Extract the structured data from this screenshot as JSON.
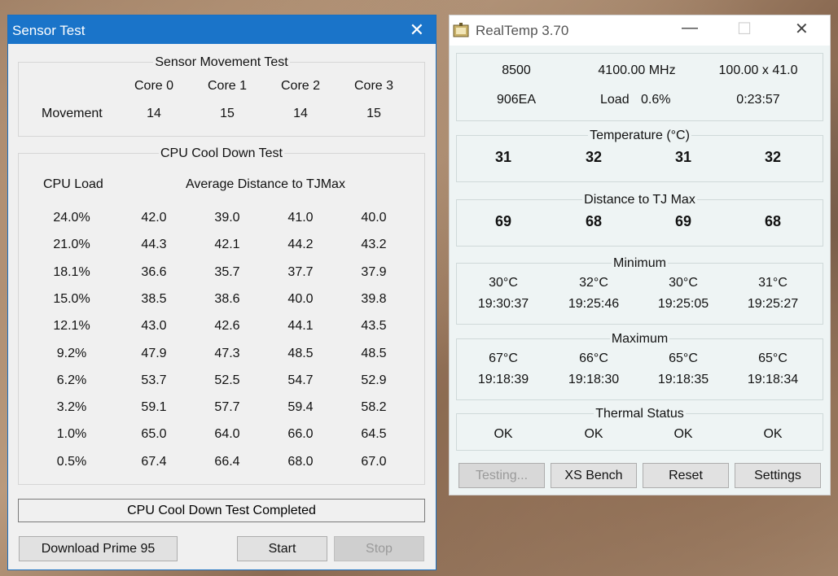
{
  "sensor_window": {
    "title": "Sensor Test",
    "movement_group": {
      "title": "Sensor Movement Test",
      "cores": [
        "Core 0",
        "Core 1",
        "Core 2",
        "Core 3"
      ],
      "row_label": "Movement",
      "values": [
        "14",
        "15",
        "14",
        "15"
      ]
    },
    "cooldown_group": {
      "title": "CPU Cool Down Test",
      "col_load": "CPU Load",
      "col_avg": "Average Distance to TJMax",
      "rows": [
        [
          "24.0%",
          "42.0",
          "39.0",
          "41.0",
          "40.0"
        ],
        [
          "21.0%",
          "44.3",
          "42.1",
          "44.2",
          "43.2"
        ],
        [
          "18.1%",
          "36.6",
          "35.7",
          "37.7",
          "37.9"
        ],
        [
          "15.0%",
          "38.5",
          "38.6",
          "40.0",
          "39.8"
        ],
        [
          "12.1%",
          "43.0",
          "42.6",
          "44.1",
          "43.5"
        ],
        [
          "9.2%",
          "47.9",
          "47.3",
          "48.5",
          "48.5"
        ],
        [
          "6.2%",
          "53.7",
          "52.5",
          "54.7",
          "52.9"
        ],
        [
          "3.2%",
          "59.1",
          "57.7",
          "59.4",
          "58.2"
        ],
        [
          "1.0%",
          "65.0",
          "64.0",
          "66.0",
          "64.5"
        ],
        [
          "0.5%",
          "67.4",
          "66.4",
          "68.0",
          "67.0"
        ]
      ]
    },
    "status": "CPU Cool Down Test Completed",
    "buttons": {
      "download": "Download Prime 95",
      "start": "Start",
      "stop": "Stop"
    }
  },
  "realtemp_window": {
    "title": "RealTemp 3.70",
    "info": {
      "cpu": "8500",
      "mhz": "4100.00 MHz",
      "multiplier": "100.00 x 41.0",
      "cpuid": "906EA",
      "load_label": "Load",
      "load_value": "0.6%",
      "uptime": "0:23:57"
    },
    "temperature": {
      "title": "Temperature (°C)",
      "values": [
        "31",
        "32",
        "31",
        "32"
      ]
    },
    "distance": {
      "title": "Distance to TJ Max",
      "values": [
        "69",
        "68",
        "69",
        "68"
      ]
    },
    "minimum": {
      "title": "Minimum",
      "temps": [
        "30°C",
        "32°C",
        "30°C",
        "31°C"
      ],
      "times": [
        "19:30:37",
        "19:25:46",
        "19:25:05",
        "19:25:27"
      ]
    },
    "maximum": {
      "title": "Maximum",
      "temps": [
        "67°C",
        "66°C",
        "65°C",
        "65°C"
      ],
      "times": [
        "19:18:39",
        "19:18:30",
        "19:18:35",
        "19:18:34"
      ]
    },
    "thermal": {
      "title": "Thermal Status",
      "values": [
        "OK",
        "OK",
        "OK",
        "OK"
      ]
    },
    "buttons": {
      "testing": "Testing...",
      "xs_bench": "XS Bench",
      "reset": "Reset",
      "settings": "Settings"
    }
  }
}
